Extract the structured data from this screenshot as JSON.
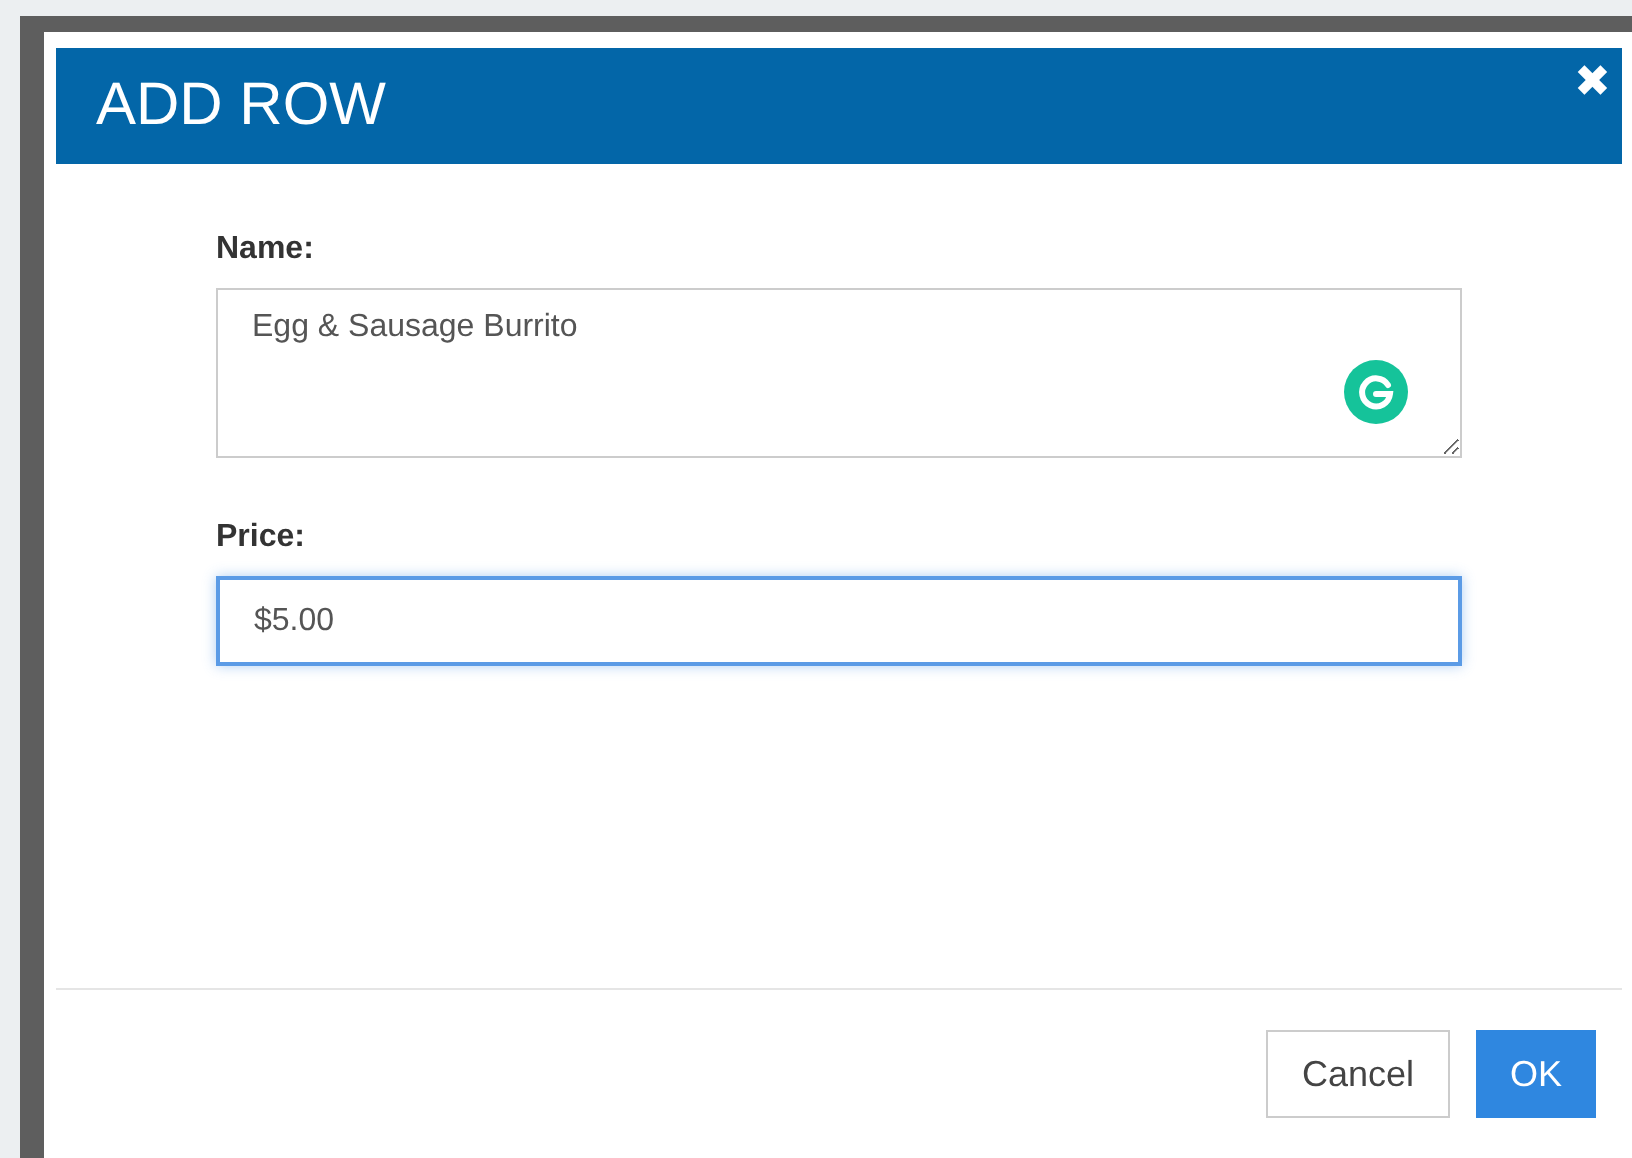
{
  "dialog": {
    "title": "ADD ROW",
    "close": "✖"
  },
  "fields": [
    {
      "kind": "textarea",
      "label": "Name:",
      "value": "Egg & Sausage Burrito",
      "focused": false
    },
    {
      "kind": "input",
      "label": "Price:",
      "value": "$5.00",
      "focused": true
    }
  ],
  "buttons": [
    {
      "label": "Cancel",
      "primary": false
    },
    {
      "label": "OK",
      "primary": true
    }
  ]
}
